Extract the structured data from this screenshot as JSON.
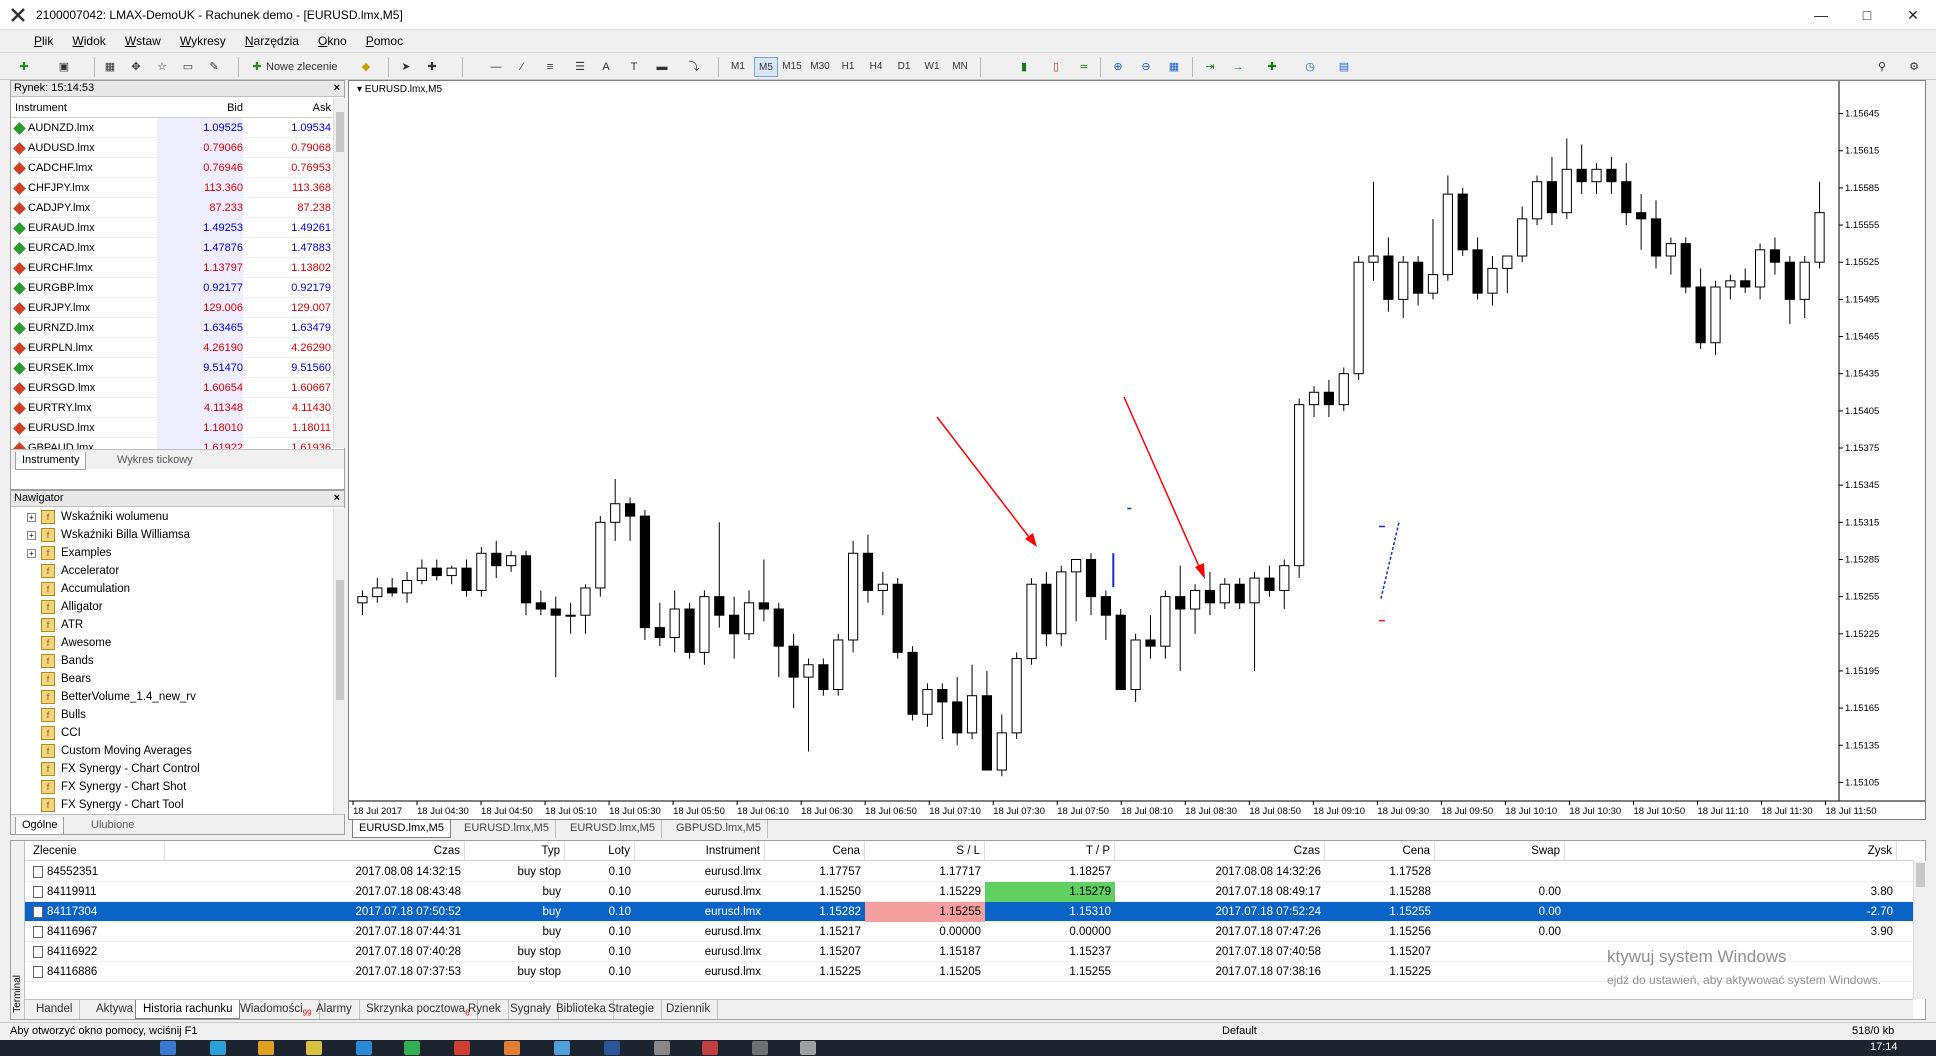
{
  "window": {
    "title": "2100007042: LMAX-DemoUK - Rachunek demo - [EURUSD.lmx,M5]",
    "logo_icon": "metatrader-icon"
  },
  "menu": [
    "Plik",
    "Widok",
    "Wstaw",
    "Wykresy",
    "Narzędzia",
    "Okno",
    "Pomoc"
  ],
  "toolbar": {
    "new_order_label": "Nowe zlecenie",
    "timeframes": [
      "M1",
      "M5",
      "M15",
      "M30",
      "H1",
      "H4",
      "D1",
      "W1",
      "MN"
    ]
  },
  "market": {
    "header": "Rynek: 15:14:53",
    "col_instrument": "Instrument",
    "col_bid": "Bid",
    "col_ask": "Ask",
    "rows": [
      {
        "symbol": "AUDNZD.lmx",
        "bid": "1.09525",
        "ask": "1.09534",
        "dir": "up"
      },
      {
        "symbol": "AUDUSD.lmx",
        "bid": "0.79066",
        "ask": "0.79068",
        "dir": "dn"
      },
      {
        "symbol": "CADCHF.lmx",
        "bid": "0.76946",
        "ask": "0.76953",
        "dir": "dn"
      },
      {
        "symbol": "CHFJPY.lmx",
        "bid": "113.360",
        "ask": "113.368",
        "dir": "dn"
      },
      {
        "symbol": "CADJPY.lmx",
        "bid": "87.233",
        "ask": "87.238",
        "dir": "dn"
      },
      {
        "symbol": "EURAUD.lmx",
        "bid": "1.49253",
        "ask": "1.49261",
        "dir": "up"
      },
      {
        "symbol": "EURCAD.lmx",
        "bid": "1.47876",
        "ask": "1.47883",
        "dir": "up"
      },
      {
        "symbol": "EURCHF.lmx",
        "bid": "1.13797",
        "ask": "1.13802",
        "dir": "dn"
      },
      {
        "symbol": "EURGBP.lmx",
        "bid": "0.92177",
        "ask": "0.92179",
        "dir": "up"
      },
      {
        "symbol": "EURJPY.lmx",
        "bid": "129.006",
        "ask": "129.007",
        "dir": "dn"
      },
      {
        "symbol": "EURNZD.lmx",
        "bid": "1.63465",
        "ask": "1.63479",
        "dir": "up"
      },
      {
        "symbol": "EURPLN.lmx",
        "bid": "4.26190",
        "ask": "4.26290",
        "dir": "dn"
      },
      {
        "symbol": "EURSEK.lmx",
        "bid": "9.51470",
        "ask": "9.51560",
        "dir": "up"
      },
      {
        "symbol": "EURSGD.lmx",
        "bid": "1.60654",
        "ask": "1.60667",
        "dir": "dn"
      },
      {
        "symbol": "EURTRY.lmx",
        "bid": "4.11348",
        "ask": "4.11430",
        "dir": "dn"
      },
      {
        "symbol": "EURUSD.lmx",
        "bid": "1.18010",
        "ask": "1.18011",
        "dir": "dn"
      },
      {
        "symbol": "GBPAUD.lmx",
        "bid": "1.61922",
        "ask": "1.61936",
        "dir": "dn"
      }
    ],
    "tabs": [
      "Instrumenty",
      "Wykres tickowy"
    ]
  },
  "navigator": {
    "header": "Nawigator",
    "items": [
      {
        "label": "Wskaźniki wolumenu",
        "expandable": true
      },
      {
        "label": "Wskaźniki Billa Williamsa",
        "expandable": true
      },
      {
        "label": "Examples",
        "expandable": true
      },
      {
        "label": "Accelerator"
      },
      {
        "label": "Accumulation"
      },
      {
        "label": "Alligator"
      },
      {
        "label": "ATR"
      },
      {
        "label": "Awesome"
      },
      {
        "label": "Bands"
      },
      {
        "label": "Bears"
      },
      {
        "label": "BetterVolume_1.4_new_rv"
      },
      {
        "label": "Bulls"
      },
      {
        "label": "CCI"
      },
      {
        "label": "Custom Moving Averages"
      },
      {
        "label": "FX Synergy - Chart Control"
      },
      {
        "label": "FX Synergy - Chart Shot"
      },
      {
        "label": "FX Synergy - Chart Tool"
      }
    ],
    "tabs": [
      "Ogólne",
      "Ulubione"
    ]
  },
  "chart": {
    "label": "EURUSD.lmx,M5",
    "up_color": "#ffffff",
    "down_color": "#000000",
    "arrow_color": "#ff0000",
    "price_ticks": [
      "1.15645",
      "1.15615",
      "1.15585",
      "1.15555",
      "1.15525",
      "1.15495",
      "1.15465",
      "1.15435",
      "1.15405",
      "1.15375",
      "1.15345",
      "1.15315",
      "1.15285",
      "1.15255",
      "1.15225",
      "1.15195",
      "1.15165",
      "1.15135",
      "1.15105"
    ],
    "time_ticks": [
      "18 Jul 2017",
      "18 Jul 04:30",
      "18 Jul 04:50",
      "18 Jul 05:10",
      "18 Jul 05:30",
      "18 Jul 05:50",
      "18 Jul 06:10",
      "18 Jul 06:30",
      "18 Jul 06:50",
      "18 Jul 07:10",
      "18 Jul 07:30",
      "18 Jul 07:50",
      "18 Jul 08:10",
      "18 Jul 08:30",
      "18 Jul 08:50",
      "18 Jul 09:10",
      "18 Jul 09:30",
      "18 Jul 09:50",
      "18 Jul 10:10",
      "18 Jul 10:30",
      "18 Jul 10:50",
      "18 Jul 11:10",
      "18 Jul 11:30",
      "18 Jul 11:50"
    ],
    "tabs": [
      "EURUSD.lmx,M5",
      "EURUSD.lmx,M5",
      "EURUSD.lmx,M5",
      "GBPUSD.lmx,M5"
    ]
  },
  "chart_data": {
    "type": "candlestick",
    "symbol": "EURUSD.lmx",
    "timeframe": "M5",
    "ylim": [
      1.1509,
      1.1566
    ],
    "candles": [
      [
        1.1525,
        1.1526,
        1.1524,
        1.15255
      ],
      [
        1.15255,
        1.1527,
        1.1525,
        1.15262
      ],
      [
        1.15262,
        1.1527,
        1.15255,
        1.15258
      ],
      [
        1.15258,
        1.15275,
        1.1525,
        1.15268
      ],
      [
        1.15268,
        1.15285,
        1.15265,
        1.15278
      ],
      [
        1.15278,
        1.15285,
        1.15268,
        1.15272
      ],
      [
        1.15272,
        1.1528,
        1.15265,
        1.15278
      ],
      [
        1.15278,
        1.15285,
        1.15255,
        1.1526
      ],
      [
        1.1526,
        1.15295,
        1.15255,
        1.1529
      ],
      [
        1.1529,
        1.153,
        1.1527,
        1.1528
      ],
      [
        1.1528,
        1.15292,
        1.15275,
        1.15288
      ],
      [
        1.15288,
        1.15292,
        1.1524,
        1.1525
      ],
      [
        1.1525,
        1.1526,
        1.1524,
        1.15245
      ],
      [
        1.15245,
        1.15255,
        1.1519,
        1.1524
      ],
      [
        1.1524,
        1.1525,
        1.15225,
        1.1524
      ],
      [
        1.1524,
        1.15265,
        1.15225,
        1.15262
      ],
      [
        1.15262,
        1.1532,
        1.15255,
        1.15315
      ],
      [
        1.15315,
        1.1535,
        1.153,
        1.1533
      ],
      [
        1.1533,
        1.15335,
        1.153,
        1.1532
      ],
      [
        1.1532,
        1.15325,
        1.1522,
        1.1523
      ],
      [
        1.1523,
        1.1525,
        1.15215,
        1.15222
      ],
      [
        1.15222,
        1.1526,
        1.1521,
        1.15245
      ],
      [
        1.15245,
        1.1525,
        1.15205,
        1.1521
      ],
      [
        1.1521,
        1.1526,
        1.152,
        1.15255
      ],
      [
        1.15255,
        1.15315,
        1.1523,
        1.1524
      ],
      [
        1.1524,
        1.15255,
        1.15205,
        1.15225
      ],
      [
        1.15225,
        1.1526,
        1.1522,
        1.1525
      ],
      [
        1.1525,
        1.15285,
        1.15235,
        1.15245
      ],
      [
        1.15245,
        1.1525,
        1.1519,
        1.15215
      ],
      [
        1.15215,
        1.15225,
        1.15165,
        1.1519
      ],
      [
        1.1519,
        1.15205,
        1.1513,
        1.152
      ],
      [
        1.152,
        1.15205,
        1.15175,
        1.1518
      ],
      [
        1.1518,
        1.15225,
        1.15175,
        1.1522
      ],
      [
        1.1522,
        1.153,
        1.1521,
        1.1529
      ],
      [
        1.1529,
        1.15305,
        1.1525,
        1.1526
      ],
      [
        1.1526,
        1.15275,
        1.1524,
        1.15265
      ],
      [
        1.15265,
        1.1527,
        1.15205,
        1.1521
      ],
      [
        1.1521,
        1.15215,
        1.15155,
        1.1516
      ],
      [
        1.1516,
        1.15185,
        1.1515,
        1.1518
      ],
      [
        1.1518,
        1.15185,
        1.1514,
        1.1517
      ],
      [
        1.1517,
        1.1519,
        1.15135,
        1.15145
      ],
      [
        1.15145,
        1.152,
        1.1514,
        1.15175
      ],
      [
        1.15175,
        1.15195,
        1.1514,
        1.15115
      ],
      [
        1.15115,
        1.1516,
        1.1511,
        1.15145
      ],
      [
        1.15145,
        1.1521,
        1.1514,
        1.15205
      ],
      [
        1.15205,
        1.1527,
        1.152,
        1.15265
      ],
      [
        1.15265,
        1.15275,
        1.15215,
        1.15225
      ],
      [
        1.15225,
        1.1528,
        1.15215,
        1.15275
      ],
      [
        1.15275,
        1.15285,
        1.15235,
        1.15285
      ],
      [
        1.15285,
        1.1529,
        1.1524,
        1.15255
      ],
      [
        1.15255,
        1.1526,
        1.1522,
        1.1524
      ],
      [
        1.1524,
        1.15245,
        1.1518,
        1.1518
      ],
      [
        1.1518,
        1.15225,
        1.1517,
        1.1522
      ],
      [
        1.1522,
        1.1524,
        1.15205,
        1.15215
      ],
      [
        1.15215,
        1.1526,
        1.15205,
        1.15255
      ],
      [
        1.15255,
        1.1528,
        1.15195,
        1.15245
      ],
      [
        1.15245,
        1.15265,
        1.15225,
        1.1526
      ],
      [
        1.1526,
        1.15275,
        1.1524,
        1.1525
      ],
      [
        1.1525,
        1.1527,
        1.15245,
        1.15265
      ],
      [
        1.15265,
        1.1527,
        1.15245,
        1.1525
      ],
      [
        1.1525,
        1.15275,
        1.15195,
        1.1527
      ],
      [
        1.1527,
        1.1528,
        1.15255,
        1.1526
      ],
      [
        1.1526,
        1.15285,
        1.15245,
        1.1528
      ],
      [
        1.1528,
        1.15415,
        1.1527,
        1.1541
      ],
      [
        1.1541,
        1.15425,
        1.154,
        1.1542
      ],
      [
        1.1542,
        1.1543,
        1.154,
        1.1541
      ],
      [
        1.1541,
        1.1544,
        1.15405,
        1.15435
      ],
      [
        1.15435,
        1.1553,
        1.1543,
        1.15525
      ],
      [
        1.15525,
        1.1559,
        1.1551,
        1.1553
      ],
      [
        1.1553,
        1.15545,
        1.15485,
        1.15495
      ],
      [
        1.15495,
        1.1553,
        1.1548,
        1.15525
      ],
      [
        1.15525,
        1.1553,
        1.1549,
        1.155
      ],
      [
        1.155,
        1.1556,
        1.15495,
        1.15515
      ],
      [
        1.15515,
        1.15595,
        1.1551,
        1.1558
      ],
      [
        1.1558,
        1.15585,
        1.1553,
        1.15535
      ],
      [
        1.15535,
        1.15545,
        1.15495,
        1.155
      ],
      [
        1.155,
        1.1553,
        1.1549,
        1.1552
      ],
      [
        1.1552,
        1.1553,
        1.155,
        1.1553
      ],
      [
        1.1553,
        1.1557,
        1.15525,
        1.1556
      ],
      [
        1.1556,
        1.15595,
        1.15555,
        1.1559
      ],
      [
        1.1559,
        1.1561,
        1.15555,
        1.15565
      ],
      [
        1.15565,
        1.15625,
        1.1556,
        1.156
      ],
      [
        1.156,
        1.1562,
        1.1558,
        1.1559
      ],
      [
        1.1559,
        1.15605,
        1.1558,
        1.156
      ],
      [
        1.156,
        1.1561,
        1.1558,
        1.1559
      ],
      [
        1.1559,
        1.15605,
        1.15555,
        1.15565
      ],
      [
        1.15565,
        1.1558,
        1.15535,
        1.1556
      ],
      [
        1.1556,
        1.15575,
        1.1552,
        1.1553
      ],
      [
        1.1553,
        1.15545,
        1.15515,
        1.1554
      ],
      [
        1.1554,
        1.15545,
        1.155,
        1.15505
      ],
      [
        1.15505,
        1.1552,
        1.15455,
        1.1546
      ],
      [
        1.1546,
        1.1551,
        1.1545,
        1.15505
      ],
      [
        1.15505,
        1.15515,
        1.15495,
        1.1551
      ],
      [
        1.1551,
        1.1552,
        1.155,
        1.15505
      ],
      [
        1.15505,
        1.1554,
        1.15495,
        1.15535
      ],
      [
        1.15535,
        1.15545,
        1.15515,
        1.15525
      ],
      [
        1.15525,
        1.1553,
        1.15475,
        1.15495
      ],
      [
        1.15495,
        1.1553,
        1.1548,
        1.15525
      ],
      [
        1.15525,
        1.1559,
        1.1552,
        1.15565
      ]
    ],
    "annotations": {
      "buy_marker_price": 1.15282,
      "sl_price": 1.15255,
      "tp_price": 1.1531,
      "arrows": 2
    }
  },
  "terminal": {
    "side_label": "Terminal",
    "columns": [
      "Zlecenie",
      "Czas",
      "Typ",
      "Loty",
      "Instrument",
      "Cena",
      "S / L",
      "T / P",
      "Czas",
      "Cena",
      "Swap",
      "Zysk"
    ],
    "rows": [
      [
        "84552351",
        "2017.08.08 14:32:15",
        "buy stop",
        "0.10",
        "eurusd.lmx",
        "1.17757",
        "1.17717",
        "1.18257",
        "2017.08.08 14:32:26",
        "1.17528",
        "",
        ""
      ],
      [
        "84119911",
        "2017.07.18 08:43:48",
        "buy",
        "0.10",
        "eurusd.lmx",
        "1.15250",
        "1.15229",
        "1.15279",
        "2017.07.18 08:49:17",
        "1.15288",
        "0.00",
        "3.80"
      ],
      [
        "84117304",
        "2017.07.18 07:50:52",
        "buy",
        "0.10",
        "eurusd.lmx",
        "1.15282",
        "1.15255",
        "1.15310",
        "2017.07.18 07:52:24",
        "1.15255",
        "0.00",
        "-2.70"
      ],
      [
        "84116967",
        "2017.07.18 07:44:31",
        "buy",
        "0.10",
        "eurusd.lmx",
        "1.15217",
        "0.00000",
        "0.00000",
        "2017.07.18 07:47:26",
        "1.15256",
        "0.00",
        "3.90"
      ],
      [
        "84116922",
        "2017.07.18 07:40:28",
        "buy stop",
        "0.10",
        "eurusd.lmx",
        "1.15207",
        "1.15187",
        "1.15237",
        "2017.07.18 07:40:58",
        "1.15207",
        "",
        ""
      ],
      [
        "84116886",
        "2017.07.18 07:37:53",
        "buy stop",
        "0.10",
        "eurusd.lmx",
        "1.15225",
        "1.15205",
        "1.15255",
        "2017.07.18 07:38:16",
        "1.15225",
        "",
        ""
      ]
    ],
    "selected_row": 2,
    "tabs": [
      {
        "label": "Handel"
      },
      {
        "label": "Aktywa"
      },
      {
        "label": "Historia rachunku",
        "active": true
      },
      {
        "label": "Wiadomości",
        "badge": "99"
      },
      {
        "label": "Alarmy"
      },
      {
        "label": "Skrzynka pocztowa",
        "badge": "6"
      },
      {
        "label": "Rynek"
      },
      {
        "label": "Sygnały"
      },
      {
        "label": "Biblioteka"
      },
      {
        "label": "Strategie"
      },
      {
        "label": "Dziennik"
      }
    ],
    "watermark_line1": "ktywuj system Windows",
    "watermark_line2": "ejdź do ustawień, aby aktywować system Windows."
  },
  "status": {
    "help": "Aby otworzyć okno pomocy, wciśnij F1",
    "profile": "Default",
    "traffic": "518/0 kb"
  },
  "taskbar": {
    "clock": "17:14"
  }
}
